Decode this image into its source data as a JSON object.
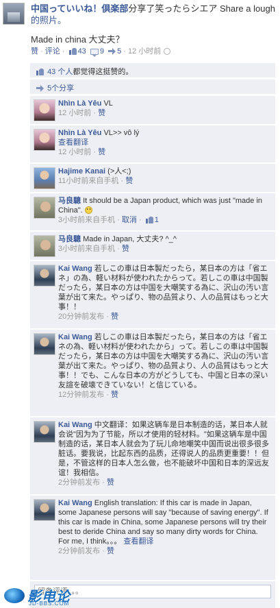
{
  "post": {
    "page_name": "中国っていいね！倶楽部",
    "headline_rest": "分享了笑ったらシエア Share a lough",
    "photo_link": "的照片。",
    "message": "Made in china 大丈夫？",
    "actions": {
      "like": "赞",
      "comment": "评论",
      "like_count": "43",
      "comment_count": "9",
      "share_count": "5",
      "time": "12 小时前"
    }
  },
  "likes_summary": {
    "count_text": "43 个人",
    "rest": "都觉得这挺赞的。"
  },
  "shares_summary": {
    "text": "5个分享"
  },
  "comments": [
    {
      "author": "Nhìn Là Yêu",
      "text": "VL",
      "time": "12 小时前",
      "like": "赞"
    },
    {
      "author": "Nhìn Là Yêu",
      "text": "VL>> vô lý",
      "translate": "查看翻译",
      "time": "12 小时前",
      "like": "赞"
    },
    {
      "author": "Hajime Kanai",
      "text": "(>人<;)",
      "time": "11小时前来自手机",
      "like": "赞"
    },
    {
      "author": "马良驄",
      "text": "It should be a Japan product, which was just \"made in China\".",
      "time": "3小时前来自手机",
      "unlike": "取消",
      "likes": "1"
    },
    {
      "author": "马良驄",
      "text": "Made in Japan, 大丈夫? ^_^",
      "time": "3小时前来自手机",
      "like": "赞"
    },
    {
      "author": "Kai Wang",
      "text": "若しこの車は日本製だったら，某日本の方は「省エネ」の為、軽い材料が使われたからって。若しこの車は中国製だったら，某日本の方は中国を大嘲笑する為に、沢山の汚い言葉が出て来た。やっぱり、物の品質より、人の品質はもっと大事！！",
      "time": "20分钟前发布",
      "like": "赞"
    },
    {
      "author": "Kai Wang",
      "text": "若しこの車は日本製だったら，某日本の方は「省エネの為、軽い材料が使われたから」って。若しこの車は中国製だったら，某日本の方は中国を大嘲笑する為に、沢山の汚い言葉が出て来た。やっぱり、物の品質より、人の品質はもっと大事！！でも、こんな日本の方がどうしても、中国と日本の深い友諠を破壊できていない！と信じている。",
      "time": "12分钟前发布",
      "like": "赞"
    },
    {
      "author": "Kai Wang",
      "text": "中文翻译：如果这辆车是日本制造的话，某日本人就会说\"因为为了节能，所以才使用的轻材料。\"如果这辆车是中国制造的话，某日本人就会为了玩儿命地嘲笑中国而说出很多很多脏话。要我说，比起东西的品质，还得说人的品质更重要！！但是，不管这样的日本人怎么做，也不能破坏中国和日本的深远友谊！我相信。",
      "time": "2分钟前发布",
      "like": "赞"
    },
    {
      "author": "Kai Wang",
      "text": "English translation: If this car is made in Japan, some Japanese persons will say \"because of saving energy\". If this car is made in China, some Japanese persons will try their best to deride China and say so many dirty words for China. For me, I think。。。",
      "translate": "查看翻译",
      "time": "2分钟前发布",
      "like": "赞"
    }
  ],
  "comment_input": {
    "placeholder": "留条评语。。。"
  },
  "watermark": {
    "text": "影电论坛",
    "sub": "JD-BBS.COM"
  }
}
